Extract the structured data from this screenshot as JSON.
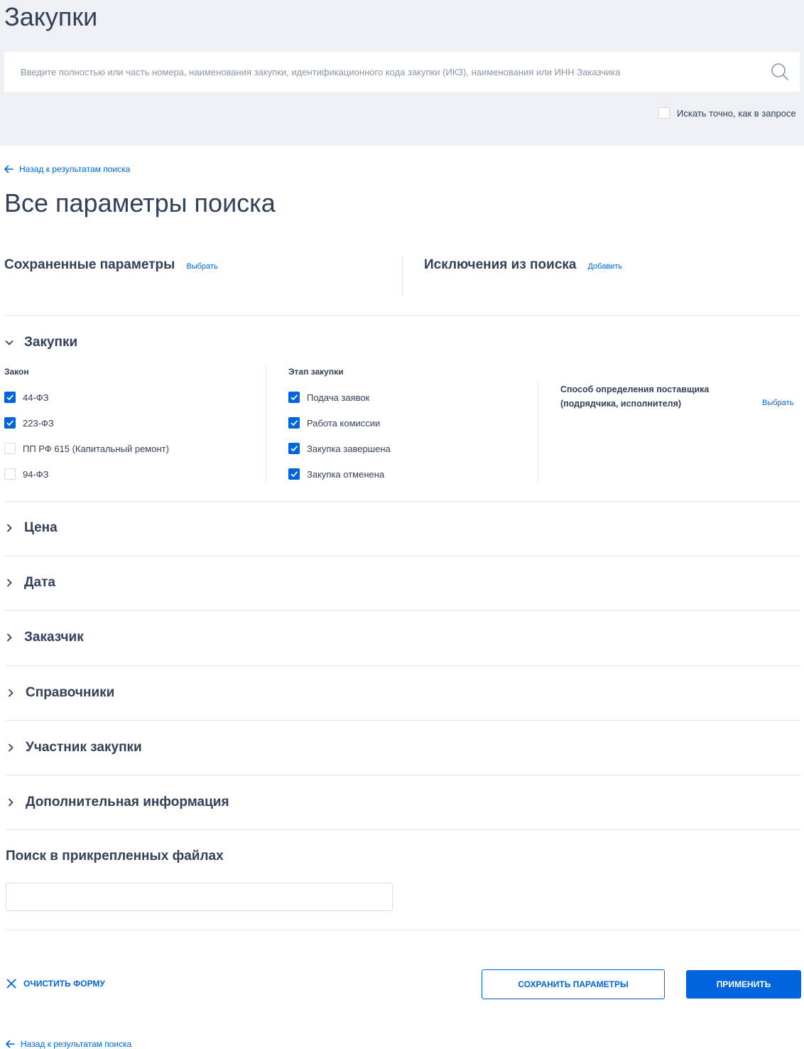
{
  "header": {
    "title": "Закупки",
    "search_placeholder": "Введите полностью или часть номера, наименования закупки, идентификационного кода закупки (ИКЗ), наименования или ИНН Заказчика",
    "exact_label": "Искать точно, как в запросе",
    "exact_checked": false
  },
  "nav": {
    "back_label": "Назад к результатам поиска"
  },
  "main": {
    "title": "Все параметры поиска",
    "saved": {
      "title": "Сохраненные параметры",
      "link": "Выбрать"
    },
    "exclusions": {
      "title": "Исключения из поиска",
      "link": "Добавить"
    }
  },
  "purchases": {
    "title": "Закупки",
    "law": {
      "title": "Закон",
      "items": [
        {
          "label": "44-ФЗ",
          "checked": true
        },
        {
          "label": "223-ФЗ",
          "checked": true
        },
        {
          "label": "ПП РФ 615 (Капитальный ремонт)",
          "checked": false
        },
        {
          "label": "94-ФЗ",
          "checked": false
        }
      ]
    },
    "stage": {
      "title": "Этап закупки",
      "items": [
        {
          "label": "Подача заявок",
          "checked": true
        },
        {
          "label": "Работа комиссии",
          "checked": true
        },
        {
          "label": "Закупка завершена",
          "checked": true
        },
        {
          "label": "Закупка отменена",
          "checked": true
        }
      ]
    },
    "supplier": {
      "title": "Способ определения поставщика (подрядчика, исполнителя)",
      "link": "Выбрать"
    }
  },
  "sections": [
    {
      "label": "Цена"
    },
    {
      "label": "Дата"
    },
    {
      "label": "Заказчик"
    },
    {
      "label": "Справочники"
    },
    {
      "label": "Участник закупки"
    },
    {
      "label": "Дополнительная информация"
    }
  ],
  "files": {
    "title": "Поиск в прикрепленных файлах",
    "value": ""
  },
  "actions": {
    "clear_label": "ОЧИСТИТЬ ФОРМУ",
    "save_label": "СОХРАНИТЬ ПАРАМЕТРЫ",
    "apply_label": "ПРИМЕНИТЬ"
  },
  "colors": {
    "accent": "#0065dd",
    "text": "#334059",
    "header_bg": "#eef0f3"
  }
}
